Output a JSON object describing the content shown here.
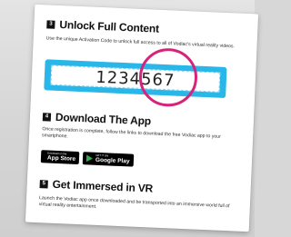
{
  "steps": [
    {
      "number": "3",
      "title": "Unlock Full Content",
      "description": "Use the unique Activation Code to unlock full access to all of Vodiac's virtual reality videos."
    },
    {
      "number": "4",
      "title": "Download The App",
      "description": "Once registration is complete, follow the links to download the free Vodiac app to your smartphone."
    },
    {
      "number": "5",
      "title": "Get Immersed in VR",
      "description": "Launch the Vodiac app once downloaded and be transported into an immersive world full of virtual reality entertainment."
    }
  ],
  "activation_code": "1234567",
  "badges": {
    "app_store": {
      "small": "Download on the",
      "big": "App Store",
      "icon": "apple-icon"
    },
    "google_play": {
      "small": "GET IT ON",
      "big": "Google Play",
      "icon": "google-play-icon"
    }
  },
  "colors": {
    "code_box": "#29b6e8",
    "highlight_circle": "#d6247a",
    "step_badge": "#111111"
  }
}
